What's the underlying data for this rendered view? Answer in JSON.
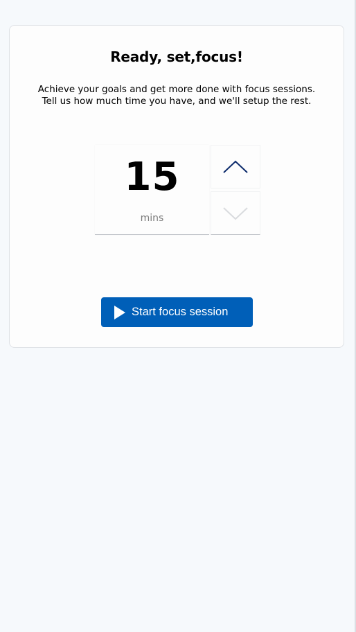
{
  "card": {
    "title": "Ready, set,focus!",
    "description_line1": "Achieve your goals and get more done with focus sessions.",
    "description_line2": "Tell us how much time you have, and we'll setup the rest."
  },
  "timer": {
    "value": "15",
    "unit": "mins",
    "up_icon": "chevron-up-icon",
    "down_icon": "chevron-down-icon"
  },
  "start_button": {
    "label": "Start focus session",
    "icon": "play-icon"
  },
  "colors": {
    "accent": "#005fb8",
    "chevron_active": "#0b2a6b",
    "chevron_disabled": "#d9dbde",
    "background": "#f6f9fc"
  }
}
